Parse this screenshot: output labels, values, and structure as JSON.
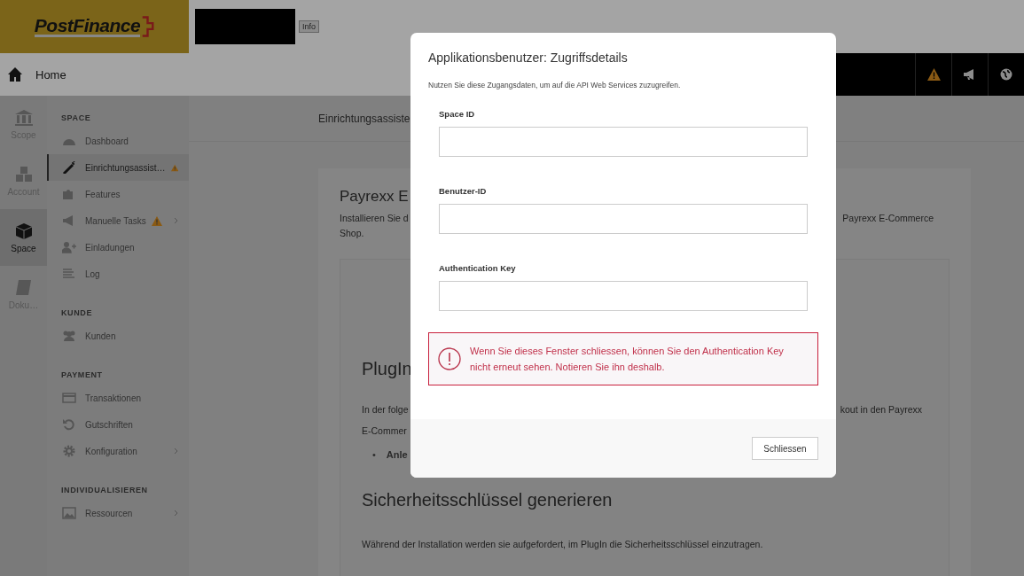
{
  "header": {
    "logo_text": "PostFinance",
    "info_button": "Info"
  },
  "nav": {
    "home_label": "Home"
  },
  "rail": [
    {
      "label": "Scope",
      "selected": false
    },
    {
      "label": "Account",
      "selected": false
    },
    {
      "label": "Space",
      "selected": true
    },
    {
      "label": "Doku…",
      "selected": false
    }
  ],
  "sidebar": {
    "sections": [
      {
        "title": "SPACE",
        "items": [
          {
            "label": "Dashboard",
            "selected": false,
            "warning": false,
            "submenu": false
          },
          {
            "label": "Einrichtungsassist…",
            "selected": true,
            "warning": true,
            "submenu": false
          },
          {
            "label": "Features",
            "selected": false,
            "warning": false,
            "submenu": false
          },
          {
            "label": "Manuelle Tasks",
            "selected": false,
            "warning": true,
            "submenu": true
          },
          {
            "label": "Einladungen",
            "selected": false,
            "warning": false,
            "submenu": false
          },
          {
            "label": "Log",
            "selected": false,
            "warning": false,
            "submenu": false
          }
        ]
      },
      {
        "title": "KUNDE",
        "items": [
          {
            "label": "Kunden",
            "selected": false,
            "warning": false,
            "submenu": false
          }
        ]
      },
      {
        "title": "PAYMENT",
        "items": [
          {
            "label": "Transaktionen",
            "selected": false,
            "warning": false,
            "submenu": false
          },
          {
            "label": "Gutschriften",
            "selected": false,
            "warning": false,
            "submenu": false
          },
          {
            "label": "Konfiguration",
            "selected": false,
            "warning": false,
            "submenu": true
          }
        ]
      },
      {
        "title": "INDIVIDUALISIEREN",
        "items": [
          {
            "label": "Ressourcen",
            "selected": false,
            "warning": false,
            "submenu": true
          }
        ]
      }
    ]
  },
  "page": {
    "title": "Einrichtungsassiste",
    "heading": "Payrexx E",
    "intro_left": "Installieren Sie d",
    "intro_right": "Payrexx E-Commerce",
    "intro_line2": "Shop.",
    "plugin_heading": "PlugIn",
    "plugin_left": "In der folge",
    "plugin_right": "kout in den Payrexx",
    "plugin_line2": "E-Commer",
    "bullet_marker": "•",
    "bullet": "Anle",
    "keys_heading": "Sicherheitsschlüssel generieren",
    "keys_text": "Während der Installation werden sie aufgefordert, im PlugIn die Sicherheitsschlüssel einzutragen."
  },
  "modal": {
    "title": "Applikationsbenutzer: Zugriffsdetails",
    "description": "Nutzen Sie diese Zugangsdaten, um auf die API Web Services zuzugreifen.",
    "fields": [
      {
        "label": "Space ID"
      },
      {
        "label": "Benutzer-ID"
      },
      {
        "label": "Authentication Key"
      }
    ],
    "alert": "Wenn Sie dieses Fenster schliessen, können Sie den Authentication Key nicht erneut sehen. Notieren Sie ihn deshalb.",
    "close_button": "Schliessen"
  }
}
